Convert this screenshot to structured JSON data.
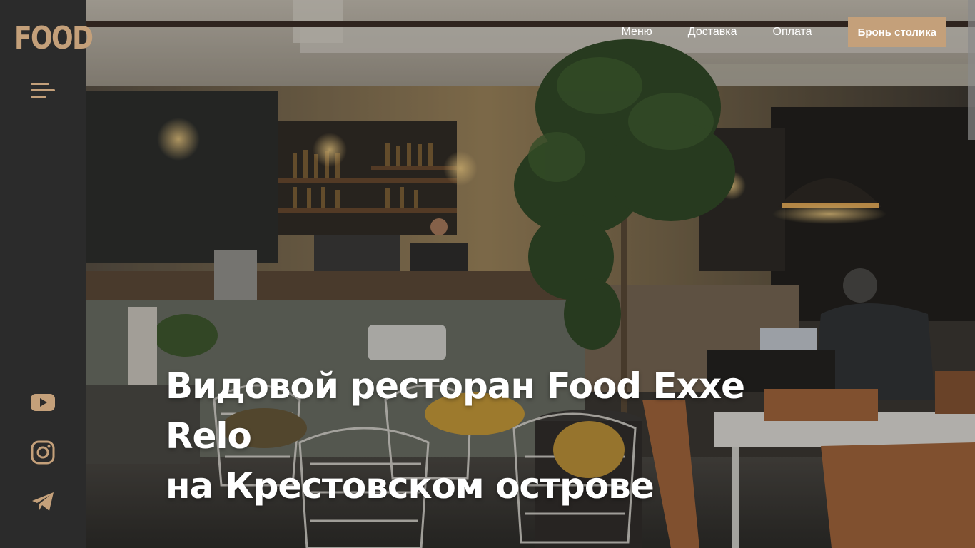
{
  "brand": {
    "logo_text": "FOOD"
  },
  "sidebar": {
    "menu_icon": "hamburger-icon",
    "social": [
      {
        "name": "youtube-icon"
      },
      {
        "name": "instagram-icon"
      },
      {
        "name": "telegram-icon"
      }
    ]
  },
  "nav": {
    "items": [
      {
        "label": "Меню"
      },
      {
        "label": "Доставка"
      },
      {
        "label": "Оплата"
      }
    ],
    "cta_label": "Бронь столика"
  },
  "hero": {
    "title_line1": "Видовой ресторан Food Exxe Relo",
    "title_line2": "на Крестовском острове"
  },
  "colors": {
    "accent": "#c4a07a",
    "sidebar_bg": "#2b2b2b",
    "text_on_hero": "#ffffff"
  }
}
